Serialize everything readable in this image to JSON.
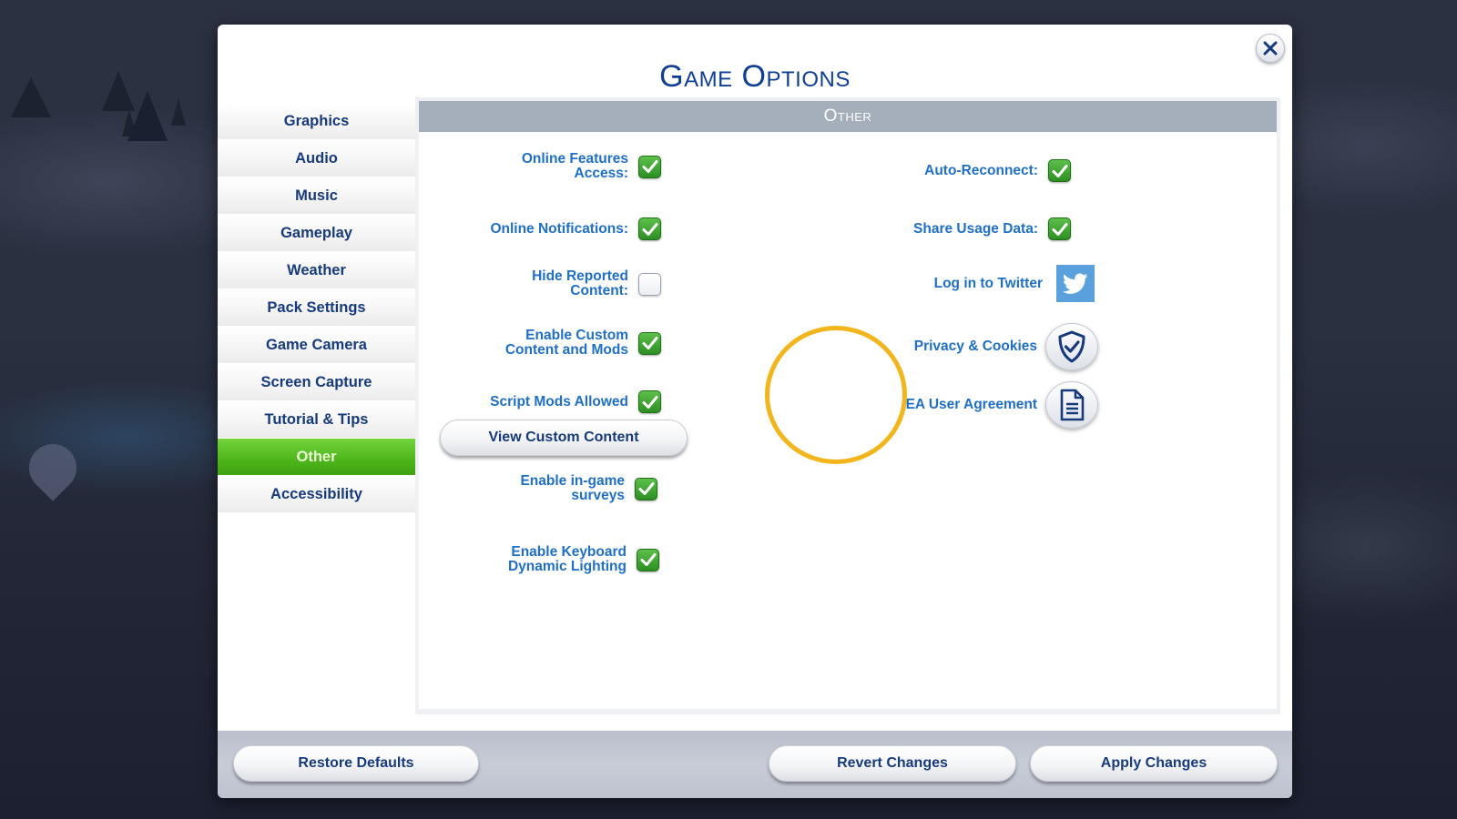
{
  "dialog": {
    "title": "Game Options",
    "close_label": "Close"
  },
  "sidebar": {
    "items": [
      {
        "label": "Graphics",
        "active": false
      },
      {
        "label": "Audio",
        "active": false
      },
      {
        "label": "Music",
        "active": false
      },
      {
        "label": "Gameplay",
        "active": false
      },
      {
        "label": "Weather",
        "active": false
      },
      {
        "label": "Pack Settings",
        "active": false
      },
      {
        "label": "Game Camera",
        "active": false
      },
      {
        "label": "Screen Capture",
        "active": false
      },
      {
        "label": "Tutorial & Tips",
        "active": false
      },
      {
        "label": "Other",
        "active": true
      },
      {
        "label": "Accessibility",
        "active": false
      }
    ]
  },
  "panel": {
    "header": "Other",
    "left_options": [
      {
        "label": "Online Features\nAccess:",
        "checked": true
      },
      {
        "label": "Online Notifications:",
        "checked": true
      },
      {
        "label": "Hide Reported\nContent:",
        "checked": false
      },
      {
        "label": "Enable Custom\nContent and Mods",
        "checked": true
      },
      {
        "label": "Script Mods Allowed",
        "checked": true
      },
      {
        "label": "Enable in-game\nsurveys",
        "checked": true
      },
      {
        "label": "Enable Keyboard\nDynamic Lighting",
        "checked": true
      }
    ],
    "view_custom_content_button": "View Custom Content",
    "right_options": [
      {
        "label": "Auto-Reconnect:",
        "checked": true
      },
      {
        "label": "Share Usage Data:",
        "checked": true
      }
    ],
    "links": {
      "twitter": {
        "label": "Log in to Twitter",
        "icon": "twitter-bird-icon"
      },
      "privacy": {
        "label": "Privacy & Cookies",
        "icon": "shield-check-icon"
      },
      "agreement": {
        "label": "EA User Agreement",
        "icon": "document-icon"
      }
    }
  },
  "footer": {
    "restore_defaults": "Restore Defaults",
    "revert_changes": "Revert Changes",
    "apply_changes": "Apply Changes"
  },
  "colors": {
    "title_blue": "#0f3f94",
    "label_blue": "#1f6fc6",
    "active_green": "#4fb71c",
    "checkbox_green": "#2e8e24",
    "highlight_ring": "#f2b61c",
    "panel_header": "#a5aebb",
    "twitter_blue": "#5aa0dc"
  }
}
